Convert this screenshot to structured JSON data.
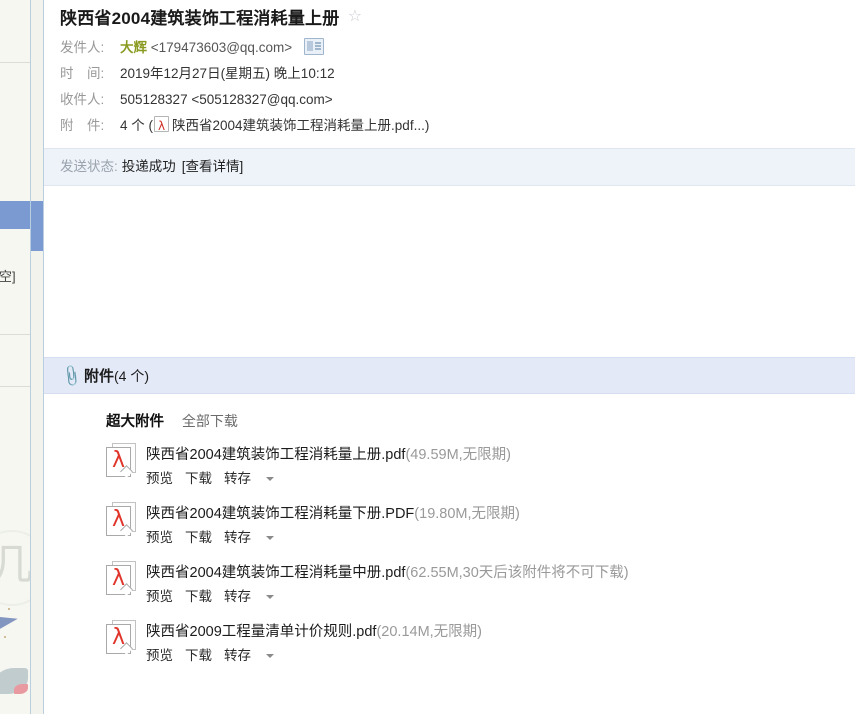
{
  "sidebar": {
    "clipped_text": "清空]"
  },
  "mail": {
    "subject": "陕西省2004建筑装饰工程消耗量上册",
    "star_icon": "star-outline-icon",
    "fields": {
      "sender_label": "发件人:",
      "sender_name": "大辉",
      "sender_address": "<179473603@qq.com>",
      "sender_vcard_icon": "vcard-icon",
      "time_label": "时　间:",
      "time_value": "2019年12月27日(星期五) 晚上10:12",
      "to_label": "收件人:",
      "to_value": "505128327 <505128327@qq.com>",
      "attach_label": "附　件:",
      "attach_count_text": "4 个 (",
      "attach_first_name": "陕西省2004建筑装饰工程消耗量上册.pdf...)",
      "attach_pdf_icon": "pdf-file-icon"
    },
    "status": {
      "label": "发送状态:",
      "value": "投递成功",
      "detail_link": "[查看详情]"
    }
  },
  "attachments": {
    "header_icon": "paperclip-icon",
    "header_title": "附件",
    "header_count": "(4 个)",
    "toolbar": {
      "group_label": "超大附件",
      "download_all": "全部下载"
    },
    "action_labels": {
      "preview": "预览",
      "download": "下载",
      "save": "转存"
    },
    "items": [
      {
        "icon": "pdf-file-icon",
        "name": "陕西省2004建筑装饰工程消耗量上册.pdf",
        "size": "(49.59M,无限期)"
      },
      {
        "icon": "pdf-file-icon",
        "name": "陕西省2004建筑装饰工程消耗量下册.PDF",
        "size": "(19.80M,无限期)"
      },
      {
        "icon": "pdf-file-icon",
        "name": "陕西省2004建筑装饰工程消耗量中册.pdf",
        "size": "(62.55M,30天后该附件将不可下载)"
      },
      {
        "icon": "pdf-file-icon",
        "name": "陕西省2009工程量清单计价规则.pdf",
        "size": "(20.14M,无限期)"
      }
    ]
  },
  "colors": {
    "accent_blue": "#7b9ad2",
    "attach_header_bg": "#e3e9f7",
    "status_bg": "#eef2f9",
    "sender_name": "#8a9a20",
    "muted": "#999999",
    "pdf_red": "#e0352b"
  }
}
